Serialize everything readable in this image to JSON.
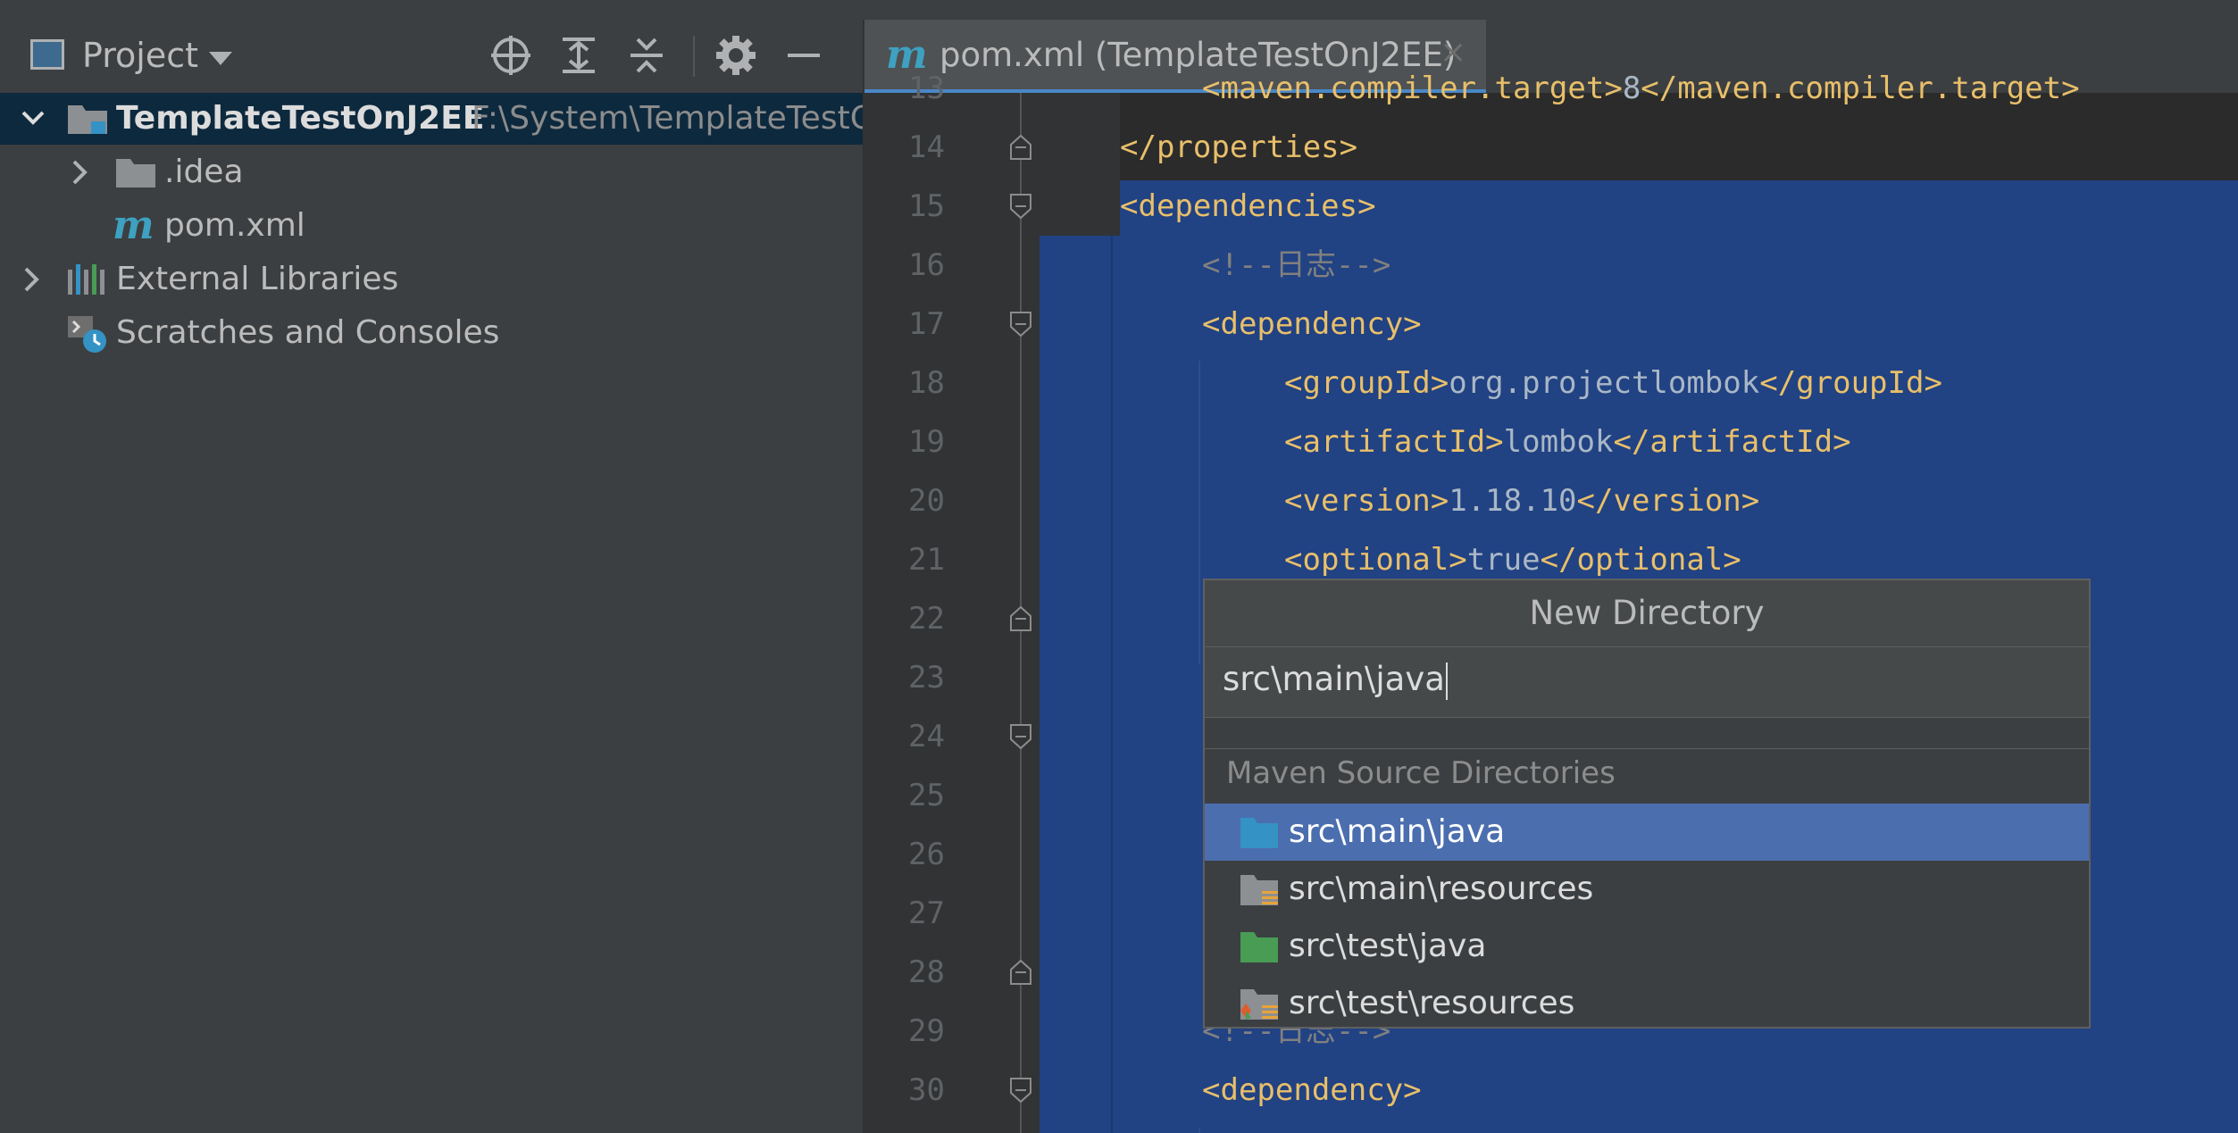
{
  "project_pane": {
    "title": "Project",
    "tree": [
      {
        "label": "TemplateTestOnJ2EE",
        "path": "F:\\System\\TemplateTestC"
      },
      {
        "label": ".idea"
      },
      {
        "label": "pom.xml"
      },
      {
        "label": "External Libraries"
      },
      {
        "label": "Scratches and Consoles"
      }
    ]
  },
  "editor": {
    "tab": {
      "icon_letter": "m",
      "label": "pom.xml (TemplateTestOnJ2EE)",
      "close": "×"
    },
    "lines": [
      {
        "num": "13",
        "tag_open": "<maven.compiler.target>",
        "text": "8",
        "tag_close": "</maven.compiler.target>"
      },
      {
        "num": "14",
        "tag_open": "</properties>"
      },
      {
        "num": "15",
        "tag_open": "<dependencies>"
      },
      {
        "num": "16",
        "comment": "<!--日志-->"
      },
      {
        "num": "17",
        "tag_open": "<dependency>"
      },
      {
        "num": "18",
        "tag_open": "<groupId>",
        "text": "org.projectlombok",
        "tag_close": "</groupId>"
      },
      {
        "num": "19",
        "tag_open": "<artifactId>",
        "text": "lombok",
        "tag_close": "</artifactId>"
      },
      {
        "num": "20",
        "tag_open": "<version>",
        "text": "1.18.10",
        "tag_close": "</version>"
      },
      {
        "num": "21",
        "tag_open": "<optional>",
        "text": "true",
        "tag_close": "</optional>"
      },
      {
        "num": "22"
      },
      {
        "num": "23"
      },
      {
        "num": "24"
      },
      {
        "num": "25"
      },
      {
        "num": "26"
      },
      {
        "num": "27"
      },
      {
        "num": "28"
      },
      {
        "num": "29",
        "comment": "<!--日志-->"
      },
      {
        "num": "30",
        "tag_open": "<dependency>"
      }
    ]
  },
  "new_directory_popup": {
    "title": "New Directory",
    "input_value": "src\\main\\java",
    "group_label": "Maven Source Directories",
    "suggestions": [
      {
        "label": "src\\main\\java",
        "icon": "source-folder-icon",
        "color": "#3592c4"
      },
      {
        "label": "src\\main\\resources",
        "icon": "resources-folder-icon",
        "color": "#8c9092"
      },
      {
        "label": "src\\test\\java",
        "icon": "test-folder-icon",
        "color": "#499c54"
      },
      {
        "label": "src\\test\\resources",
        "icon": "test-resources-folder-icon",
        "color": "#8c9092"
      }
    ]
  },
  "colors": {
    "selection": "#214283",
    "tag": "#e8bf6a",
    "text": "#a9b7c6",
    "comment": "#808080"
  }
}
